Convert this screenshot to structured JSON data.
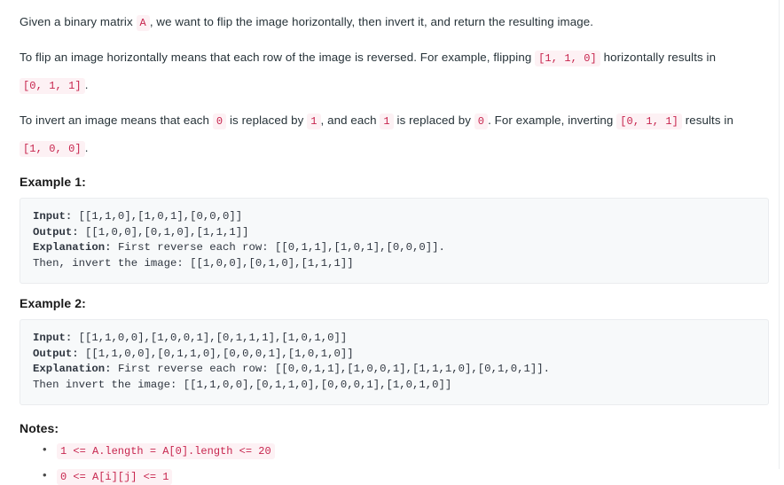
{
  "page": {
    "background": "#ffffff",
    "inline_code_color": "#c7254e",
    "inline_code_bg": "#fdf1f4",
    "code_block_bg": "#f7f9fa",
    "code_block_border": "#eaecef"
  },
  "intro": {
    "p1": {
      "seg1": "Given a binary matrix ",
      "code1": "A",
      "seg2": ", we want to flip the image horizontally, then invert it, and return the resulting image."
    },
    "p2": {
      "seg1": "To flip an image horizontally means that each row of the image is reversed.  For example, flipping ",
      "code1": "[1, 1, 0]",
      "seg2": " horizontally results in ",
      "code2": "[0, 1, 1]",
      "seg3": "."
    },
    "p3": {
      "seg1": "To invert an image means that each ",
      "code1": "0",
      "seg2": " is replaced by ",
      "code2": "1",
      "seg3": ", and each ",
      "code3": "1",
      "seg4": " is replaced by ",
      "code4": "0",
      "seg5": ". For example, inverting ",
      "code5": "[0, 1, 1]",
      "seg6": " results in ",
      "code6": "[1, 0, 0]",
      "seg7": "."
    }
  },
  "examples": [
    {
      "title": "Example 1:",
      "input_label": "Input:",
      "input_value": " [[1,1,0],[1,0,1],[0,0,0]]",
      "output_label": "Output:",
      "output_value": " [[1,0,0],[0,1,0],[1,1,1]]",
      "explanation_label": "Explanation:",
      "explanation_value": " First reverse each row: [[0,1,1],[1,0,1],[0,0,0]].",
      "explanation_line2": "Then, invert the image: [[1,0,0],[0,1,0],[1,1,1]]"
    },
    {
      "title": "Example 2:",
      "input_label": "Input:",
      "input_value": " [[1,1,0,0],[1,0,0,1],[0,1,1,1],[1,0,1,0]]",
      "output_label": "Output:",
      "output_value": " [[1,1,0,0],[0,1,1,0],[0,0,0,1],[1,0,1,0]]",
      "explanation_label": "Explanation:",
      "explanation_value": " First reverse each row: [[0,0,1,1],[1,0,0,1],[1,1,1,0],[0,1,0,1]].",
      "explanation_line2": "Then invert the image: [[1,1,0,0],[0,1,1,0],[0,0,0,1],[1,0,1,0]]"
    }
  ],
  "notes": {
    "title": "Notes:",
    "items": [
      "1 <= A.length = A[0].length <= 20",
      "0 <= A[i][j] <= 1"
    ]
  }
}
